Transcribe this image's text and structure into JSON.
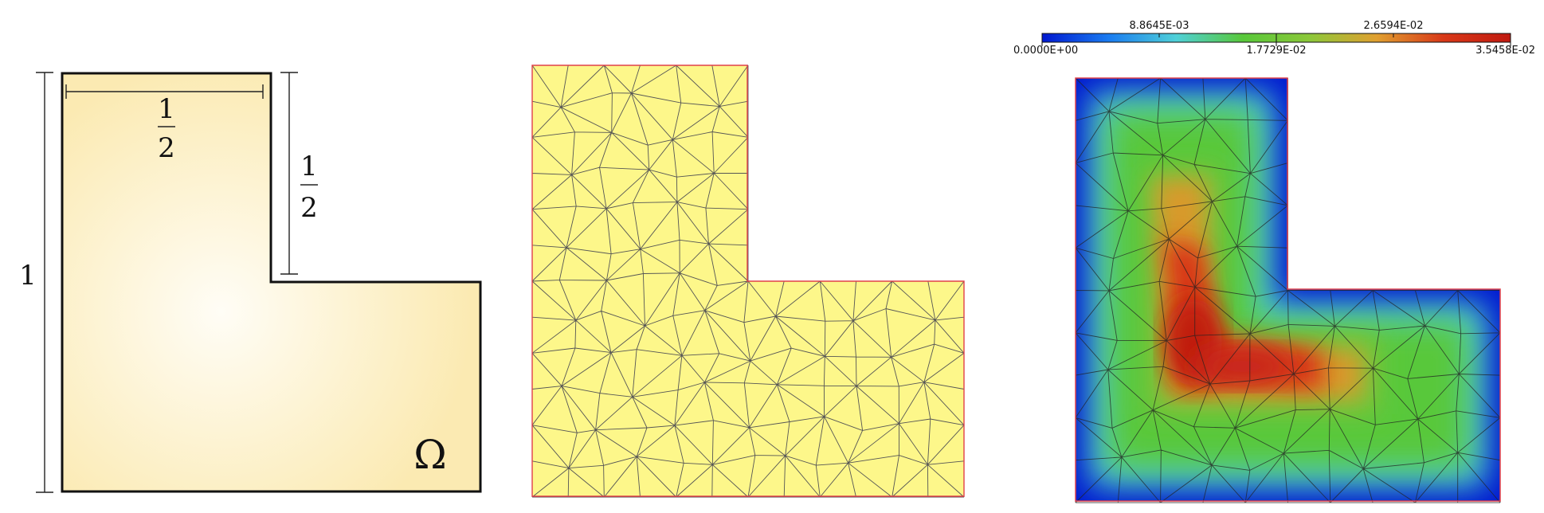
{
  "domain_panel": {
    "dim_total": "1",
    "dim_top": {
      "num": "1",
      "den": "2"
    },
    "dim_notch": {
      "num": "1",
      "den": "2"
    },
    "domain_symbol": "Ω",
    "colors": {
      "fill_edge": "#fbeab2",
      "fill_center": "#fffdf6",
      "outline": "#111111"
    }
  },
  "mesh_panel": {
    "colors": {
      "fill": "#fdf78a",
      "edges": "#555555",
      "boundary": "#e0404a"
    }
  },
  "solution_panel": {
    "colorbar": {
      "minor_labels": [
        "8.8645E-03",
        "2.6594E-02"
      ],
      "major_labels": [
        "0.0000E+00",
        "1.7729E-02",
        "3.5458E-02"
      ],
      "colormap": [
        "#0018d0",
        "#1a7cf0",
        "#4fd0d8",
        "#58c83a",
        "#8cc83a",
        "#e0a030",
        "#d83818",
        "#c01a10"
      ]
    },
    "colors": {
      "edges": "#222222",
      "boundary": "#e0404a"
    }
  }
}
